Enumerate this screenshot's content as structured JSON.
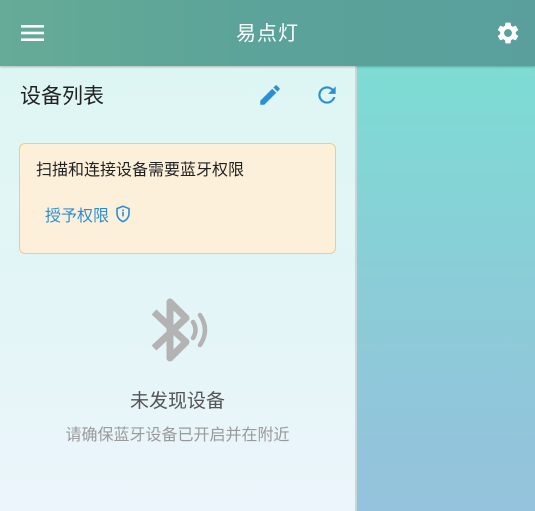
{
  "app": {
    "title": "易点灯"
  },
  "toolbar": {
    "menu_icon": "menu-icon",
    "settings_icon": "gear-icon"
  },
  "device_panel": {
    "title": "设备列表",
    "edit_icon": "pencil-icon",
    "refresh_icon": "refresh-icon"
  },
  "permission_card": {
    "message": "扫描和连接设备需要蓝牙权限",
    "grant_label": "授予权限",
    "grant_icon": "shield-icon"
  },
  "empty_state": {
    "icon": "bluetooth-searching-icon",
    "title": "未发现设备",
    "subtitle": "请确保蓝牙设备已开启并在附近"
  },
  "colors": {
    "header": "#5ea59a",
    "accent": "#2b8fd6",
    "warn_bg": "#fdf0db",
    "warn_border": "#f4c98d"
  }
}
